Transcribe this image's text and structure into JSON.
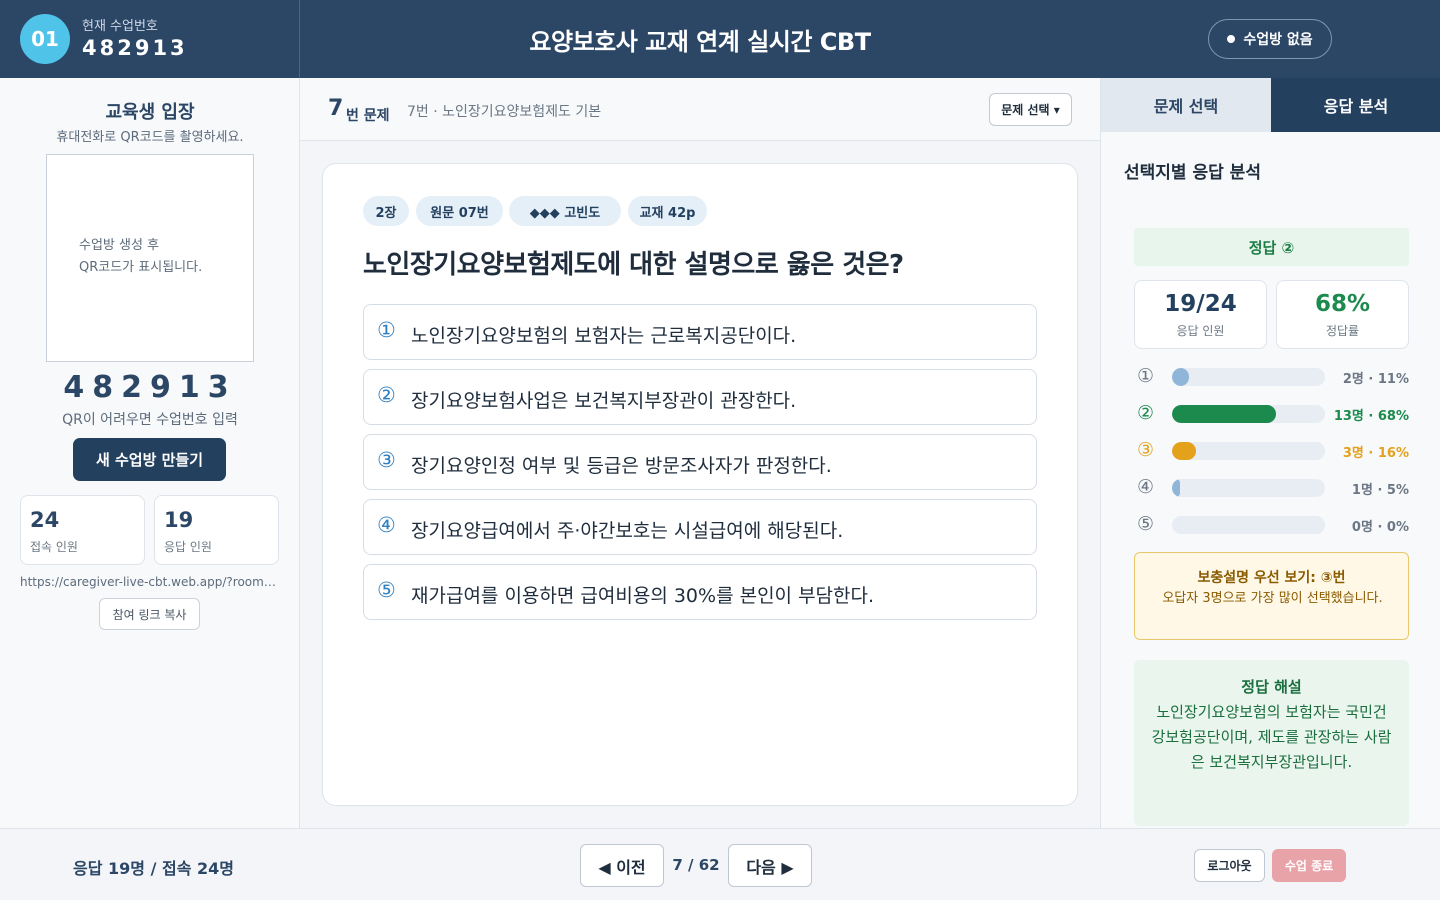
{
  "header": {
    "session_badge": "01",
    "session_caption": "현재 수업번호",
    "session_code": "482913",
    "title": "요양보호사 교재 연계 실시간 CBT",
    "room_status": "수업방 없음"
  },
  "left": {
    "title": "교육생 입장",
    "subtitle": "휴대전화로 QR코드를 촬영하세요.",
    "qr_placeholder_line1": "수업방 생성 후",
    "qr_placeholder_line2": "QR코드가 표시됩니다.",
    "big_code": "482913",
    "code_hint": "QR이 어려우면 수업번호 입력",
    "new_room_label": "새 수업방 만들기",
    "stats": [
      {
        "value": "24",
        "label": "접속 인원"
      },
      {
        "value": "19",
        "label": "응답 인원"
      }
    ],
    "join_url": "https://caregiver-live-cbt.web.app/?room=482913",
    "copy_link_label": "참여 링크 복사"
  },
  "question": {
    "number": "7",
    "number_suffix": "번 문제",
    "subtitle": "7번 · 노인장기요양보험제도 기본",
    "select_label": "문제 선택 ▾",
    "tags": [
      "2장",
      "원문 07번",
      "◆◆◆ 고빈도",
      "교재 42p"
    ],
    "text": "노인장기요양보험제도에 대한 설명으로 옳은 것은?",
    "options": [
      {
        "num": "①",
        "text": "노인장기요양보험의 보험자는 근로복지공단이다."
      },
      {
        "num": "②",
        "text": "장기요양보험사업은 보건복지부장관이 관장한다."
      },
      {
        "num": "③",
        "text": "장기요양인정 여부 및 등급은 방문조사자가 판정한다."
      },
      {
        "num": "④",
        "text": "장기요양급여에서 주·야간보호는 시설급여에 해당된다."
      },
      {
        "num": "⑤",
        "text": "재가급여를 이용하면 급여비용의 30%를 본인이 부담한다."
      }
    ]
  },
  "right": {
    "tabs": [
      "문제 선택",
      "응답 분석"
    ],
    "title": "선택지별 응답 분석",
    "correct_label": "정답 ②",
    "response_value": "19/24",
    "response_label": "응답 인원",
    "rate_value": "68%",
    "rate_label": "정답률",
    "distribution": [
      {
        "num": "①",
        "label": "2명 · 11%",
        "fraction": 0.11,
        "color": "#8fb6d8"
      },
      {
        "num": "②",
        "label": "13명 · 68%",
        "fraction": 0.68,
        "color": "#1b8a4c"
      },
      {
        "num": "③",
        "label": "3명 · 16%",
        "fraction": 0.16,
        "color": "#e4a11b"
      },
      {
        "num": "④",
        "label": "1명 · 5%",
        "fraction": 0.05,
        "color": "#8fb6d8"
      },
      {
        "num": "⑤",
        "label": "0명 · 0%",
        "fraction": 0.0,
        "color": "#8fb6d8"
      }
    ],
    "warn_title": "보충설명 우선 보기: ③번",
    "warn_body": "오답자 3명으로 가장 많이 선택했습니다.",
    "explain_title": "정답 해설",
    "explain_body": "노인장기요양보험의 보험자는 국민건강보험공단이며, 제도를 관장하는 사람은 보건복지부장관입니다."
  },
  "bottom": {
    "stat": "응답 19명 / 접속 24명",
    "prev_label": "◀ 이전",
    "page_indicator": "7 / 62",
    "next_label": "다음 ▶",
    "logout_label": "로그아웃",
    "end_label": "수업 종료"
  },
  "colors": {
    "header_bg": "#2c4666",
    "accent": "#4fc3e8",
    "correct": "#1b8a4c",
    "warning": "#e4a11b"
  }
}
